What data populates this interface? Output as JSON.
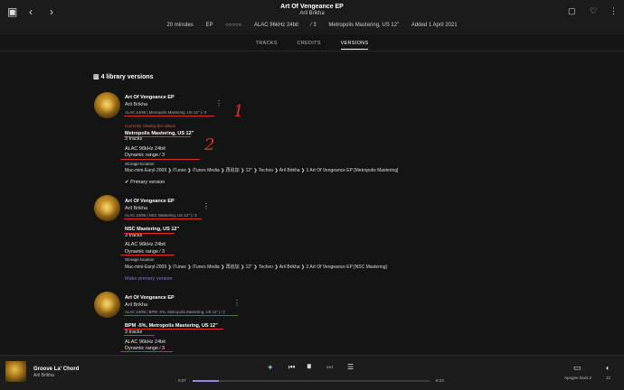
{
  "header": {
    "title": "Art Of Vengeance EP",
    "artist": "Aril Brikha",
    "meta": [
      "20 minutes",
      "EP",
      "○○○○○",
      "ALAC 96kHz 24bit",
      "⁄ 3",
      "Metropolis Mastering, US 12\"",
      "Added 1 April 2021"
    ]
  },
  "tabs": [
    "TRACKS",
    "CREDITS",
    "VERSIONS"
  ],
  "section_title": "4 library versions",
  "annotations": [
    "1",
    "2"
  ],
  "versions": [
    {
      "title": "Art Of Vengeance EP",
      "artist": "Aril Brikha",
      "subtitle": "ALAC 24/96 | Metropolis Mastering, US 12\" | ⁄ 3",
      "viewing": "Currently viewing this album",
      "edition": "Metropolis Mastering, US 12\"",
      "tracks": "3 tracks",
      "format": "ALAC 96kHz 24bit",
      "dr": "Dynamic range  ⁄ 3",
      "storage_label": "Storage location",
      "path": "Mac-mini-Earyl-2009  ❯  iTunes  ❯  iTunes Media  ❯  再追加  ❯  12\"  ❯  Techno  ❯  Aril Brikha  ❯  1 Art Of Vengeance EP [Metropolis Mastering]",
      "primary": "✔ Primary version"
    },
    {
      "title": "Art Of Vengeance EP",
      "artist": "Aril Brikha",
      "subtitle": "ALAC 24/96 | NSC Mastering, US 12\" | ⁄ 3",
      "edition": "NSC Mastering, US 12\"",
      "tracks": "3 tracks",
      "format": "ALAC 96kHz 24bit",
      "dr": "Dynamic range  ⁄ 3",
      "storage_label": "Storage location",
      "path": "Mac-mini-Earyl-2009  ❯  iTunes  ❯  iTunes Media  ❯  再追加  ❯  12\"  ❯  Techno  ❯  Aril Brikha  ❯  2 Art Of Vengeance EP [NSC Mastering]",
      "primary": "Make primary version"
    },
    {
      "title": "Art Of Vengeance EP",
      "artist": "Aril Brikha",
      "subtitle": "ALAC 24/96 | BPM -5%, Metropolis Mastering, US 12\" | ⁄ 3",
      "edition": "BPM -5%, Metropolis Mastering, US 12\"",
      "tracks": "3 tracks",
      "format": "ALAC 96kHz 24bit",
      "dr": "Dynamic range  ⁄ 3"
    }
  ],
  "player": {
    "track": "Groove La' Chord",
    "artist": "Aril Brikha",
    "elapsed": "0:37",
    "total": "8:23",
    "progress": 0.11,
    "device": "Apogee Duet 2",
    "volume": "12"
  },
  "colors": {
    "accent": "#8b8be0",
    "annotation": "#e03020",
    "link": "#7b78d6"
  }
}
